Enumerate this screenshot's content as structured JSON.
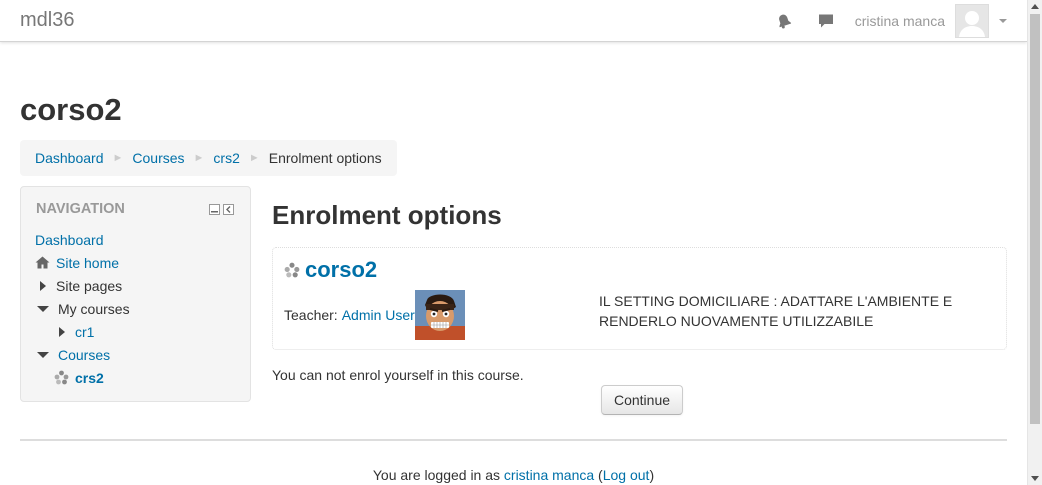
{
  "navbar": {
    "brand": "mdl36",
    "user_name": "cristina manca",
    "icons": [
      "notifications-icon",
      "messages-icon",
      "chevron-down-icon"
    ]
  },
  "page": {
    "heading": "corso2"
  },
  "breadcrumb": {
    "items": [
      "Dashboard",
      "Courses",
      "crs2"
    ],
    "current": "Enrolment options",
    "separator": "►"
  },
  "navigation": {
    "title": "NAVIGATION",
    "items": {
      "dashboard": "Dashboard",
      "site_home": "Site home",
      "site_pages": "Site pages",
      "my_courses": "My courses",
      "cr1": "cr1",
      "courses": "Courses",
      "crs2": "crs2"
    }
  },
  "main": {
    "title": "Enrolment options",
    "course": {
      "name": "corso2",
      "teacher_label": "Teacher:",
      "teacher_name": "Admin User",
      "summary": "IL SETTING DOMICILIARE : ADATTARE L'AMBIENTE E RENDERLO NUOVAMENTE UTILIZZABILE"
    },
    "notice": "You can not enrol yourself in this course.",
    "continue_label": "Continue"
  },
  "footer": {
    "prefix": "You are logged in as ",
    "user": "cristina manca",
    "open_paren": " (",
    "logout": "Log out",
    "close_paren": ")"
  },
  "colors": {
    "link": "#0070a8",
    "text": "#333333",
    "block_bg": "#f5f5f5"
  }
}
